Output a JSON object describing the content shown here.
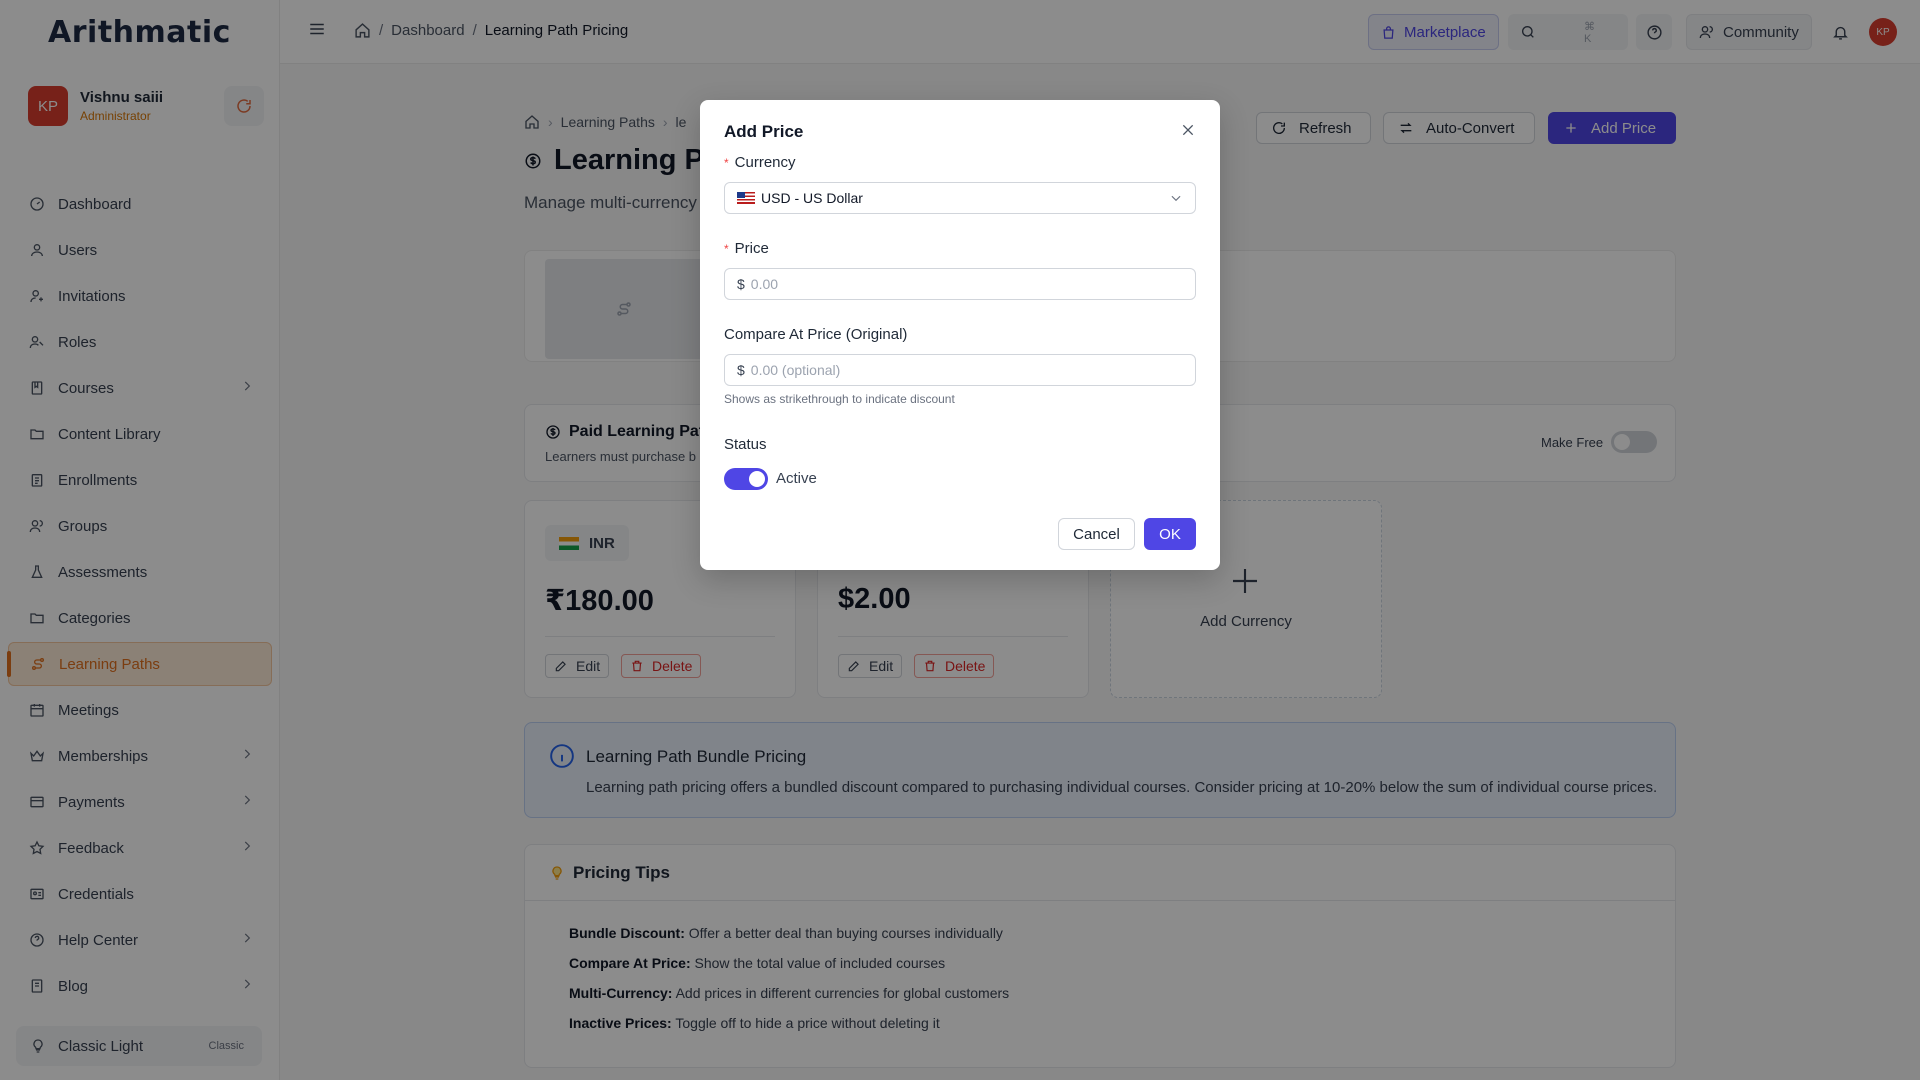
{
  "app": {
    "logo": "Arithmatic"
  },
  "user": {
    "initials": "KP",
    "name": "Vishnu saiii",
    "role": "Administrator"
  },
  "sidebar": {
    "items": [
      {
        "label": "Dashboard",
        "icon": "dashboard-icon"
      },
      {
        "label": "Users",
        "icon": "user-icon"
      },
      {
        "label": "Invitations",
        "icon": "user-plus-icon"
      },
      {
        "label": "Roles",
        "icon": "roles-icon"
      },
      {
        "label": "Courses",
        "icon": "book-icon"
      },
      {
        "label": "Content Library",
        "icon": "folder-icon"
      },
      {
        "label": "Enrollments",
        "icon": "clipboard-icon"
      },
      {
        "label": "Groups",
        "icon": "group-icon"
      },
      {
        "label": "Assessments",
        "icon": "flask-icon"
      },
      {
        "label": "Categories",
        "icon": "folder-icon"
      },
      {
        "label": "Learning Paths",
        "icon": "path-icon"
      },
      {
        "label": "Meetings",
        "icon": "calendar-icon"
      },
      {
        "label": "Memberships",
        "icon": "crown-icon"
      },
      {
        "label": "Payments",
        "icon": "card-icon"
      },
      {
        "label": "Feedback",
        "icon": "star-icon"
      },
      {
        "label": "Credentials",
        "icon": "id-card-icon"
      },
      {
        "label": "Help Center",
        "icon": "help-icon"
      },
      {
        "label": "Blog",
        "icon": "book-icon"
      }
    ],
    "theme_label": "Classic Light",
    "theme_tag": "Classic"
  },
  "topbar": {
    "breadcrumb": [
      "Dashboard",
      "Learning Path Pricing"
    ],
    "marketplace": "Marketplace",
    "shortcut": "⌘ K",
    "community": "Community",
    "avatar": "KP"
  },
  "page": {
    "breadcrumb": [
      "Learning Paths",
      "le"
    ],
    "title": "Learning Pa",
    "subtitle": "Manage multi-currency p",
    "actions": {
      "refresh": "Refresh",
      "auto_convert": "Auto-Convert",
      "add_price": "Add Price"
    },
    "paid": {
      "title": "Paid Learning Path",
      "desc": "Learners must purchase b",
      "make_free": "Make Free"
    },
    "prices": [
      {
        "currency": "INR",
        "amount": "₹180.00",
        "edit": "Edit",
        "delete": "Delete"
      },
      {
        "currency": "",
        "amount": "$2.00",
        "edit": "Edit",
        "delete": "Delete"
      }
    ],
    "add_currency": "Add Currency",
    "bundle": {
      "title": "Learning Path Bundle Pricing",
      "desc": "Learning path pricing offers a bundled discount compared to purchasing individual courses. Consider pricing at 10-20% below the sum of individual course prices."
    },
    "tips": {
      "title": "Pricing Tips",
      "items": [
        {
          "term": "Bundle Discount:",
          "text": "Offer a better deal than buying courses individually"
        },
        {
          "term": "Compare At Price:",
          "text": "Show the total value of included courses"
        },
        {
          "term": "Multi-Currency:",
          "text": "Add prices in different currencies for global customers"
        },
        {
          "term": "Inactive Prices:",
          "text": "Toggle off to hide a price without deleting it"
        }
      ]
    }
  },
  "modal": {
    "title": "Add Price",
    "currency_label": "Currency",
    "currency_value": "USD - US Dollar",
    "price_label": "Price",
    "price_prefix": "$",
    "price_placeholder": "0.00",
    "compare_label": "Compare At Price (Original)",
    "compare_prefix": "$",
    "compare_placeholder": "0.00 (optional)",
    "compare_hint": "Shows as strikethrough to indicate discount",
    "status_label": "Status",
    "status_value": "Active",
    "cancel": "Cancel",
    "ok": "OK"
  }
}
